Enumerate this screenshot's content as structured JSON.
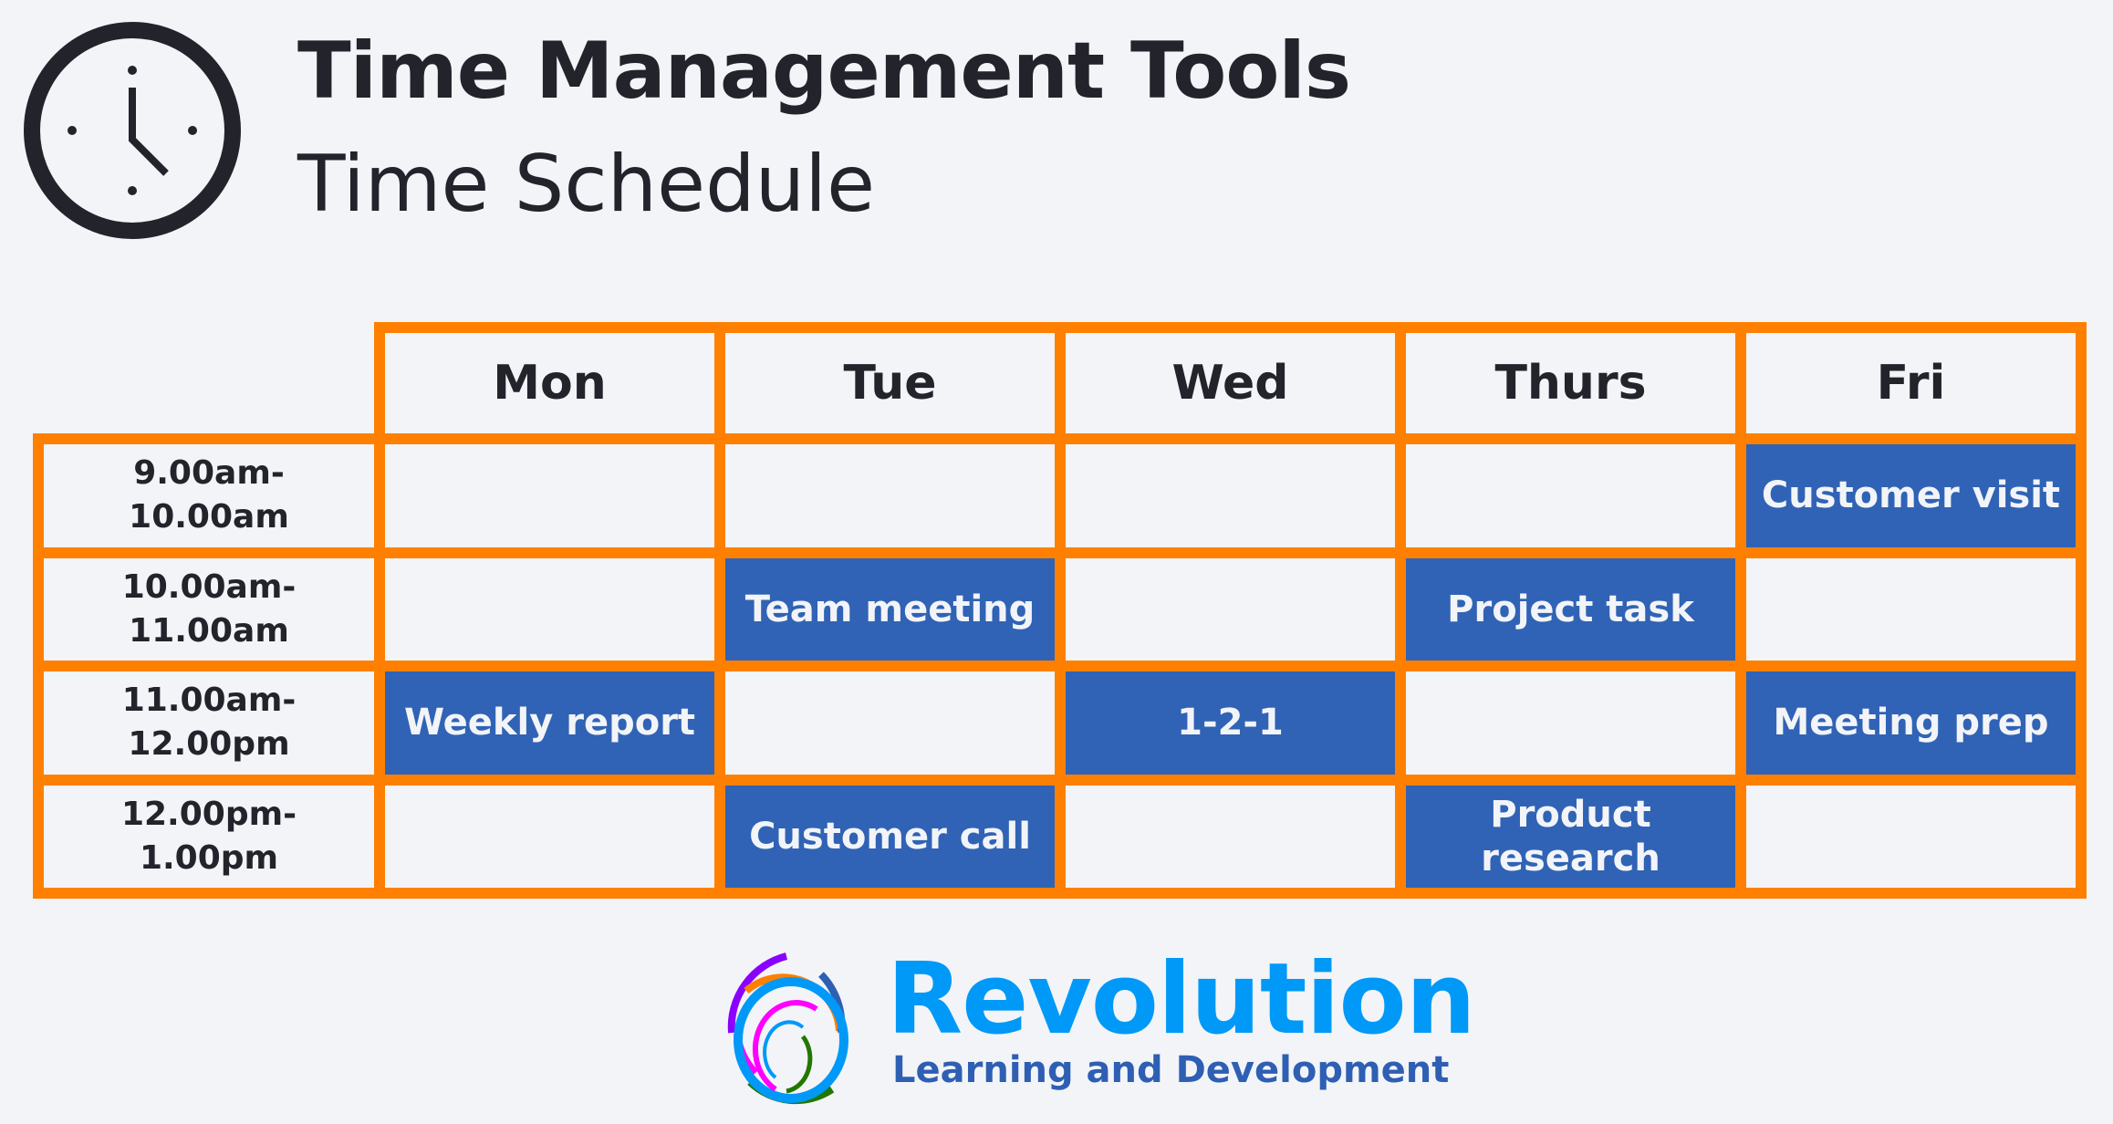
{
  "header": {
    "title": "Time Management Tools",
    "subtitle": "Time Schedule",
    "icon": "clock-icon"
  },
  "colors": {
    "accent_border": "#ff8000",
    "event_fill": "#3063b5",
    "text": "#22232b",
    "background": "#f2f4f8"
  },
  "schedule": {
    "days": [
      "Mon",
      "Tue",
      "Wed",
      "Thurs",
      "Fri"
    ],
    "slots": [
      {
        "label_line1": "9.00am-",
        "label_line2": "10.00am",
        "events": [
          "",
          "",
          "",
          "",
          "Customer visit"
        ]
      },
      {
        "label_line1": "10.00am-",
        "label_line2": "11.00am",
        "events": [
          "",
          "Team meeting",
          "",
          "Project task",
          ""
        ]
      },
      {
        "label_line1": "11.00am-",
        "label_line2": "12.00pm",
        "events": [
          "Weekly report",
          "",
          "1-2-1",
          "",
          "Meeting prep"
        ]
      },
      {
        "label_line1": "12.00pm-",
        "label_line2": "1.00pm",
        "events": [
          "",
          "Customer call",
          "",
          "Product research",
          ""
        ]
      }
    ]
  },
  "logo": {
    "name": "Revolution",
    "tagline": "Learning and Development",
    "icon": "revolution-swirl-logo-icon"
  }
}
